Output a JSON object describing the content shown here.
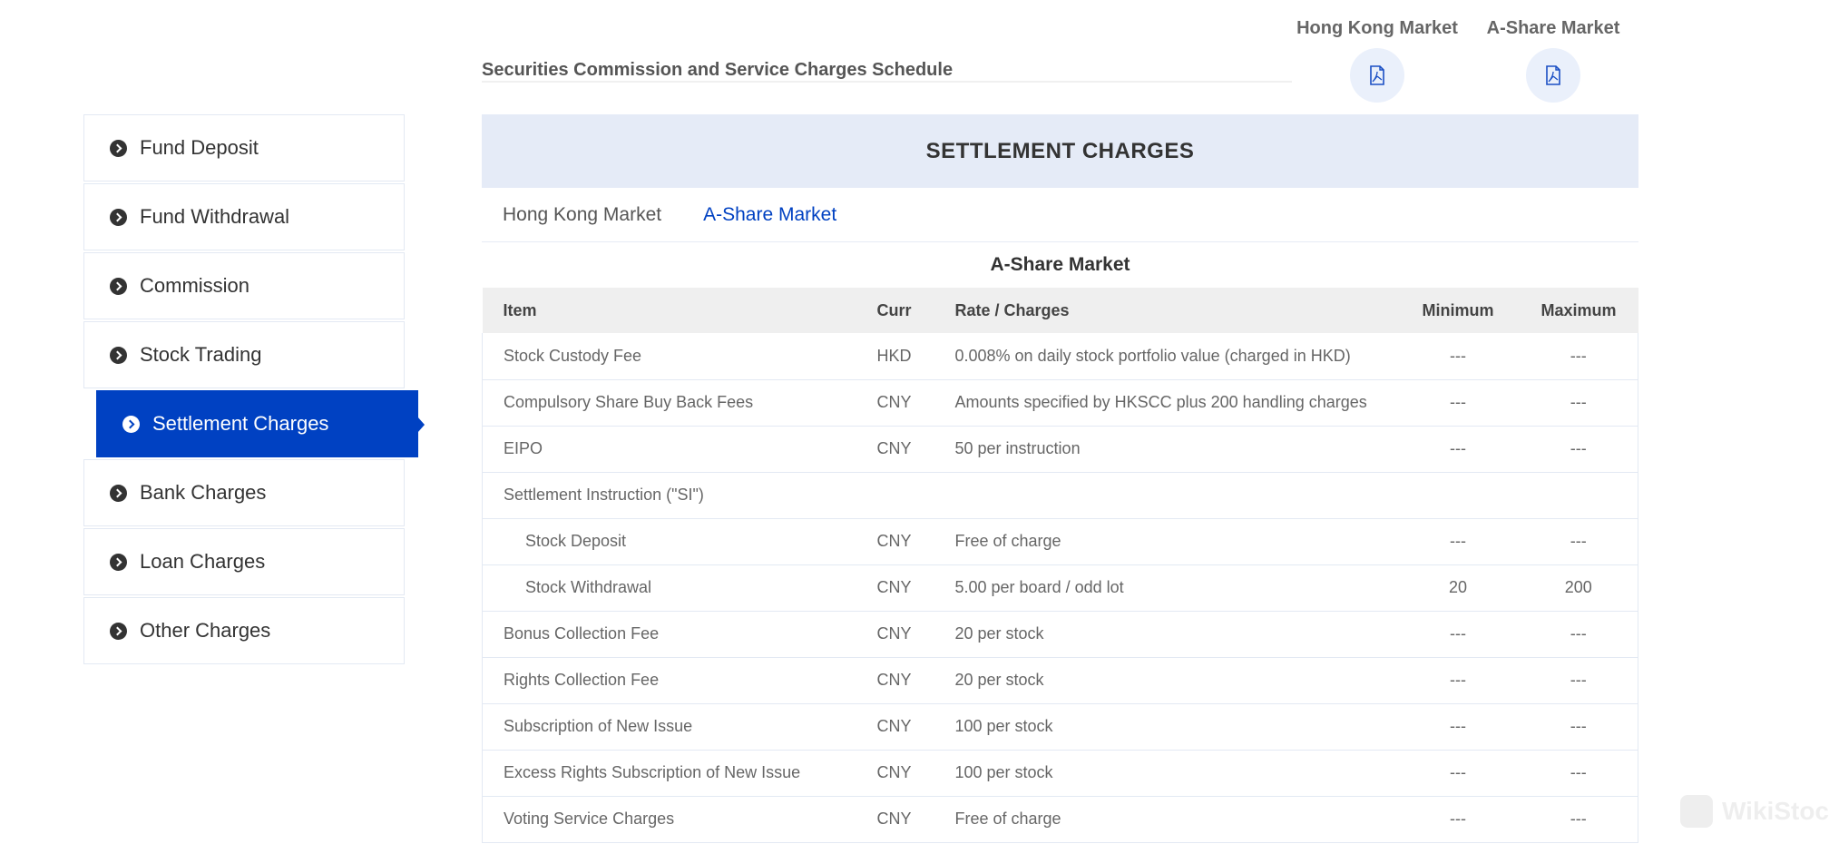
{
  "header": {
    "schedule_title": "Securities Commission and Service Charges Schedule",
    "downloads": [
      {
        "label": "Hong Kong Market",
        "icon": "pdf-icon"
      },
      {
        "label": "A-Share Market",
        "icon": "pdf-icon"
      }
    ]
  },
  "sidebar": {
    "items": [
      {
        "label": "Fund Deposit",
        "active": false
      },
      {
        "label": "Fund Withdrawal",
        "active": false
      },
      {
        "label": "Commission",
        "active": false
      },
      {
        "label": "Stock Trading",
        "active": false
      },
      {
        "label": "Settlement Charges",
        "active": true
      },
      {
        "label": "Bank Charges",
        "active": false
      },
      {
        "label": "Loan Charges",
        "active": false
      },
      {
        "label": "Other Charges",
        "active": false
      }
    ]
  },
  "main": {
    "section_title": "SETTLEMENT CHARGES",
    "tabs": [
      {
        "label": "Hong Kong Market",
        "active": false
      },
      {
        "label": "A-Share Market",
        "active": true
      }
    ],
    "table_title": "A-Share Market",
    "table": {
      "columns": [
        "Item",
        "Curr",
        "Rate / Charges",
        "Minimum",
        "Maximum"
      ],
      "rows": [
        {
          "item": "Stock Custody Fee",
          "curr": "HKD",
          "rate": "0.008% on daily stock portfolio value (charged in HKD)",
          "min": "---",
          "max": "---"
        },
        {
          "item": "Compulsory Share Buy Back Fees",
          "curr": "CNY",
          "rate": "Amounts specified by HKSCC plus 200 handling charges",
          "min": "---",
          "max": "---"
        },
        {
          "item": "EIPO",
          "curr": "CNY",
          "rate": "50 per instruction",
          "min": "---",
          "max": "---"
        },
        {
          "item": "Settlement Instruction (\"SI\")",
          "curr": "",
          "rate": "",
          "min": "",
          "max": ""
        },
        {
          "item": "Stock Deposit",
          "curr": "CNY",
          "rate": "Free of charge",
          "min": "---",
          "max": "---",
          "indent": true
        },
        {
          "item": "Stock Withdrawal",
          "curr": "CNY",
          "rate": "5.00 per board / odd lot",
          "min": "20",
          "max": "200",
          "indent": true
        },
        {
          "item": "Bonus Collection Fee",
          "curr": "CNY",
          "rate": "20 per stock",
          "min": "---",
          "max": "---"
        },
        {
          "item": "Rights Collection Fee",
          "curr": "CNY",
          "rate": "20 per stock",
          "min": "---",
          "max": "---"
        },
        {
          "item": "Subscription of New Issue",
          "curr": "CNY",
          "rate": "100 per stock",
          "min": "---",
          "max": "---"
        },
        {
          "item": "Excess Rights Subscription of New Issue",
          "curr": "CNY",
          "rate": "100 per stock",
          "min": "---",
          "max": "---"
        },
        {
          "item": "Voting Service Charges",
          "curr": "CNY",
          "rate": "Free of charge",
          "min": "---",
          "max": "---"
        }
      ]
    }
  },
  "watermark": {
    "text": "WikiStock"
  },
  "colors": {
    "accent": "#0041c2",
    "band": "#e5ebf7",
    "table_header": "#efefef"
  }
}
